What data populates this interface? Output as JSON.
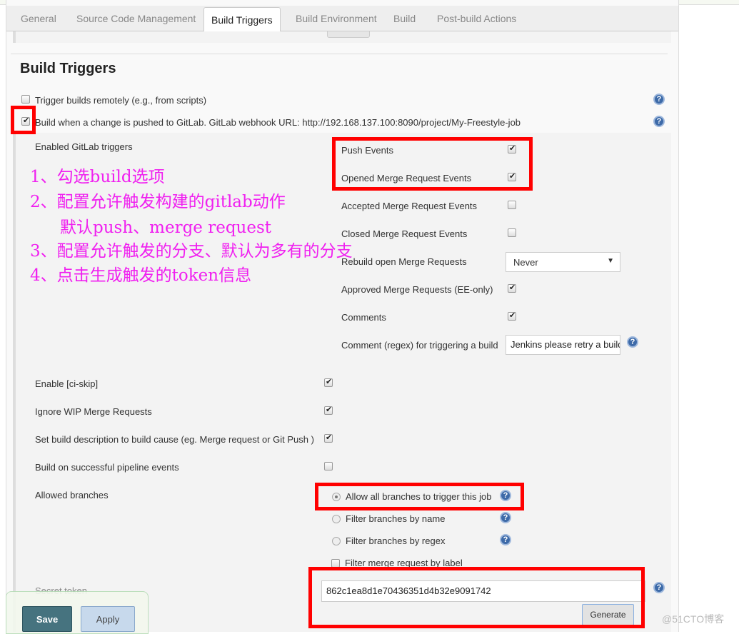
{
  "tabs": [
    "General",
    "Source Code Management",
    "Build Triggers",
    "Build Environment",
    "Build",
    "Post-build Actions"
  ],
  "active_tab": "Build Triggers",
  "section_title": "Build Triggers",
  "triggers": {
    "remote": {
      "label": "Trigger builds remotely (e.g., from scripts)",
      "checked": false
    },
    "gitlab": {
      "label": "Build when a change is pushed to GitLab. GitLab webhook URL: http://192.168.137.100:8090/project/My-Freestyle-job",
      "checked": true
    }
  },
  "gitlab": {
    "enabled_label": "Enabled GitLab triggers",
    "events": [
      {
        "label": "Push Events",
        "checked": true
      },
      {
        "label": "Opened Merge Request Events",
        "checked": true
      },
      {
        "label": "Accepted Merge Request Events",
        "checked": false
      },
      {
        "label": "Closed Merge Request Events",
        "checked": false
      }
    ],
    "rebuild_label": "Rebuild open Merge Requests",
    "rebuild_value": "Never",
    "approved": {
      "label": "Approved Merge Requests (EE-only)",
      "checked": true
    },
    "comments": {
      "label": "Comments",
      "checked": true
    },
    "comment_regex_label": "Comment (regex) for triggering a build",
    "comment_regex_value": "Jenkins please retry a build",
    "options": [
      {
        "label": "Enable [ci-skip]",
        "checked": true
      },
      {
        "label": "Ignore WIP Merge Requests",
        "checked": true
      },
      {
        "label": "Set build description to build cause (eg. Merge request or Git Push )",
        "checked": true
      },
      {
        "label": "Build on successful pipeline events",
        "checked": false
      }
    ],
    "allowed_branches_label": "Allowed branches",
    "branches": [
      {
        "label": "Allow all branches to trigger this job",
        "selected": true
      },
      {
        "label": "Filter branches by name",
        "selected": false
      },
      {
        "label": "Filter branches by regex",
        "selected": false
      }
    ],
    "filter_label": {
      "label": "Filter merge request by label",
      "checked": false
    },
    "secret_label": "Secret token",
    "secret_value": "862c1ea8d1e70436351d4b32e9091742",
    "generate": "Generate"
  },
  "annotations": [
    "1、勾选build选项",
    "2、配置允许触发构建的gitlab动作",
    "默认push、merge request",
    "3、配置允许触发的分支、默认为多有的分支",
    "4、点击生成触发的token信息"
  ],
  "buttons": {
    "save": "Save",
    "apply": "Apply"
  },
  "watermark": "@51CTO博客",
  "colors": {
    "annotation": "#f020f0",
    "highlight": "#ff0000",
    "save": "#46737f"
  }
}
